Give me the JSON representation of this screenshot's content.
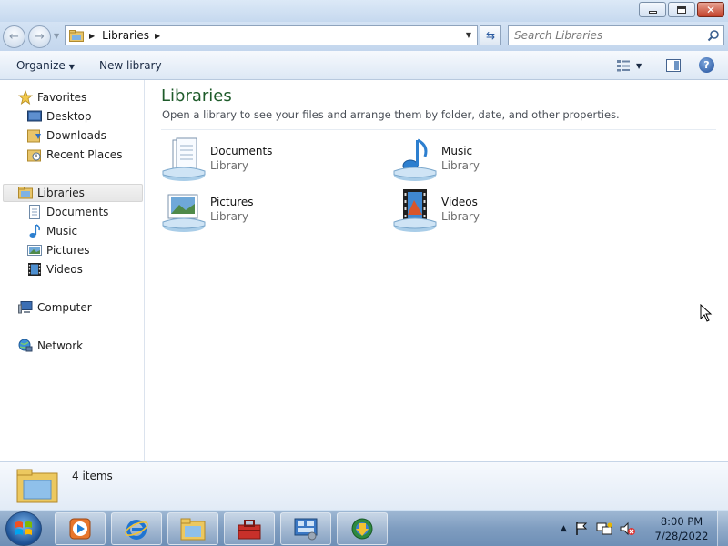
{
  "address_bar": {
    "path_label": "Libraries",
    "search_placeholder": "Search Libraries"
  },
  "toolbar": {
    "organize_label": "Organize",
    "new_library_label": "New library",
    "help_label": "?"
  },
  "nav_pane": {
    "favorites": {
      "label": "Favorites",
      "items": [
        {
          "label": "Desktop",
          "icon": "desktop-icon"
        },
        {
          "label": "Downloads",
          "icon": "downloads-icon"
        },
        {
          "label": "Recent Places",
          "icon": "recent-places-icon"
        }
      ]
    },
    "libraries": {
      "label": "Libraries",
      "selected": true,
      "items": [
        {
          "label": "Documents",
          "icon": "documents-icon"
        },
        {
          "label": "Music",
          "icon": "music-icon"
        },
        {
          "label": "Pictures",
          "icon": "pictures-icon"
        },
        {
          "label": "Videos",
          "icon": "videos-icon"
        }
      ]
    },
    "computer_label": "Computer",
    "network_label": "Network"
  },
  "content": {
    "title": "Libraries",
    "subtitle": "Open a library to see your files and arrange them by folder, date, and other properties.",
    "libraries": [
      {
        "name": "Documents",
        "type": "Library",
        "icon": "documents-library-icon"
      },
      {
        "name": "Music",
        "type": "Library",
        "icon": "music-library-icon"
      },
      {
        "name": "Pictures",
        "type": "Library",
        "icon": "pictures-library-icon"
      },
      {
        "name": "Videos",
        "type": "Library",
        "icon": "videos-library-icon"
      }
    ]
  },
  "details_pane": {
    "item_count": "4 items"
  },
  "taskbar": {
    "pinned": [
      "media-player-icon",
      "internet-explorer-icon",
      "windows-explorer-icon",
      "toolbox-icon",
      "control-panel-icon",
      "download-manager-icon"
    ],
    "clock": {
      "time": "8:00 PM",
      "date": "7/28/2022"
    }
  },
  "colors": {
    "title_green": "#1e5b2a",
    "taskbar": "#7f9dc0",
    "chrome": "#d4e3f4"
  }
}
